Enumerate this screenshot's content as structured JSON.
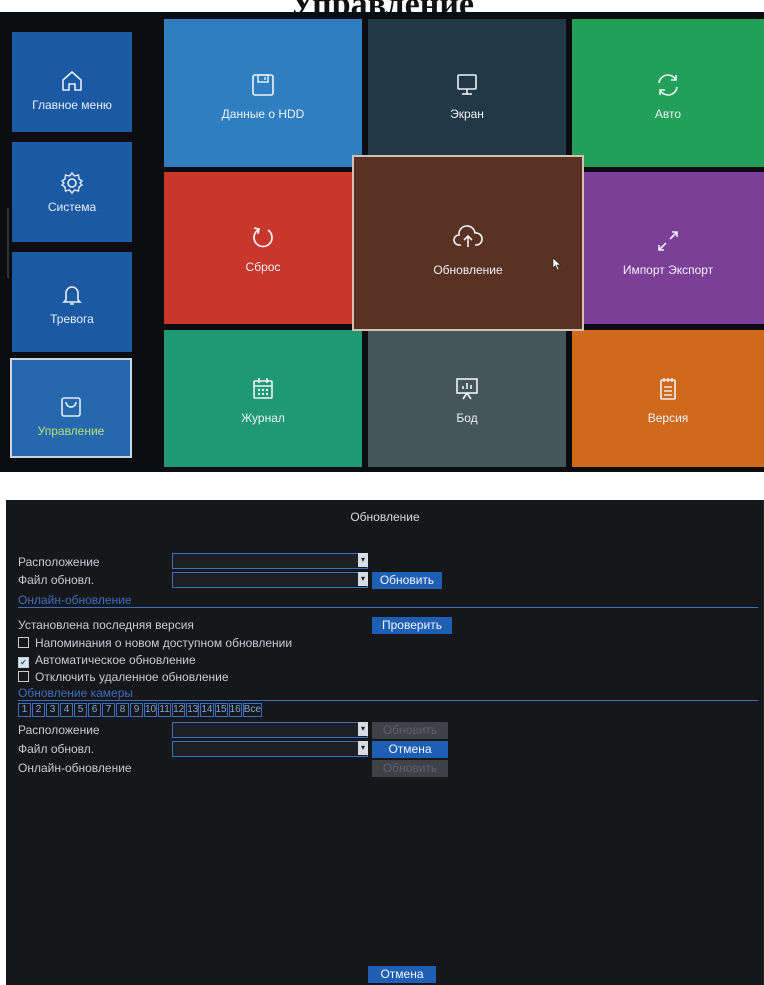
{
  "heading": "Управление",
  "menu": {
    "sidebar": [
      {
        "label": "Главное меню",
        "icon": "home-icon"
      },
      {
        "label": "Система",
        "icon": "gear-icon"
      },
      {
        "label": "Тревога",
        "icon": "bell-icon"
      },
      {
        "label": "Управление",
        "icon": "bag-icon",
        "selected": true
      }
    ],
    "tiles": [
      {
        "label": "Данные о HDD",
        "icon": "floppy-icon",
        "color": "#2f7fc0"
      },
      {
        "label": "Экран",
        "icon": "monitor-icon",
        "color": "#213947"
      },
      {
        "label": "Авто",
        "icon": "refresh-icon",
        "color": "#22a05a"
      },
      {
        "label": "Сброс",
        "icon": "reset-icon",
        "color": "#c9362b"
      },
      {
        "label": "Обновление",
        "icon": "cloud-upload-icon",
        "color": "#5a3224",
        "selected": true
      },
      {
        "label": "Импорт Экспорт",
        "icon": "expand-icon",
        "color": "#7c3f98"
      },
      {
        "label": "Журнал",
        "icon": "calendar-icon",
        "color": "#1f9873"
      },
      {
        "label": "Бод",
        "icon": "presentation-icon",
        "color": "#45565a"
      },
      {
        "label": "Версия",
        "icon": "clipboard-icon",
        "color": "#cf6a1d"
      }
    ]
  },
  "dialog": {
    "title": "Обновление",
    "location_label": "Расположение",
    "file_label": "Файл обновл.",
    "update_button": "Обновить",
    "online_group": "Онлайн-обновление",
    "latest_version_text": "Установлена последняя версия",
    "check_button": "Проверить",
    "options": [
      {
        "label": "Напоминания о новом доступном обновлении",
        "checked": false
      },
      {
        "label": "Автоматическое обновление",
        "checked": true
      },
      {
        "label": "Отключить удаленное обновление",
        "checked": false
      }
    ],
    "camera_group": "Обновление камеры",
    "camera_numbers": [
      "1",
      "2",
      "3",
      "4",
      "5",
      "6",
      "7",
      "8",
      "9",
      "10",
      "11",
      "12",
      "13",
      "14",
      "15",
      "16",
      "Все"
    ],
    "cam_location_label": "Расположение",
    "cam_file_label": "Файл обновл.",
    "cam_online_label": "Онлайн-обновление",
    "cam_update_button": "Обновить",
    "cam_cancel_button": "Отмена",
    "cam_online_button": "Обновить",
    "cancel_button": "Отмена"
  }
}
